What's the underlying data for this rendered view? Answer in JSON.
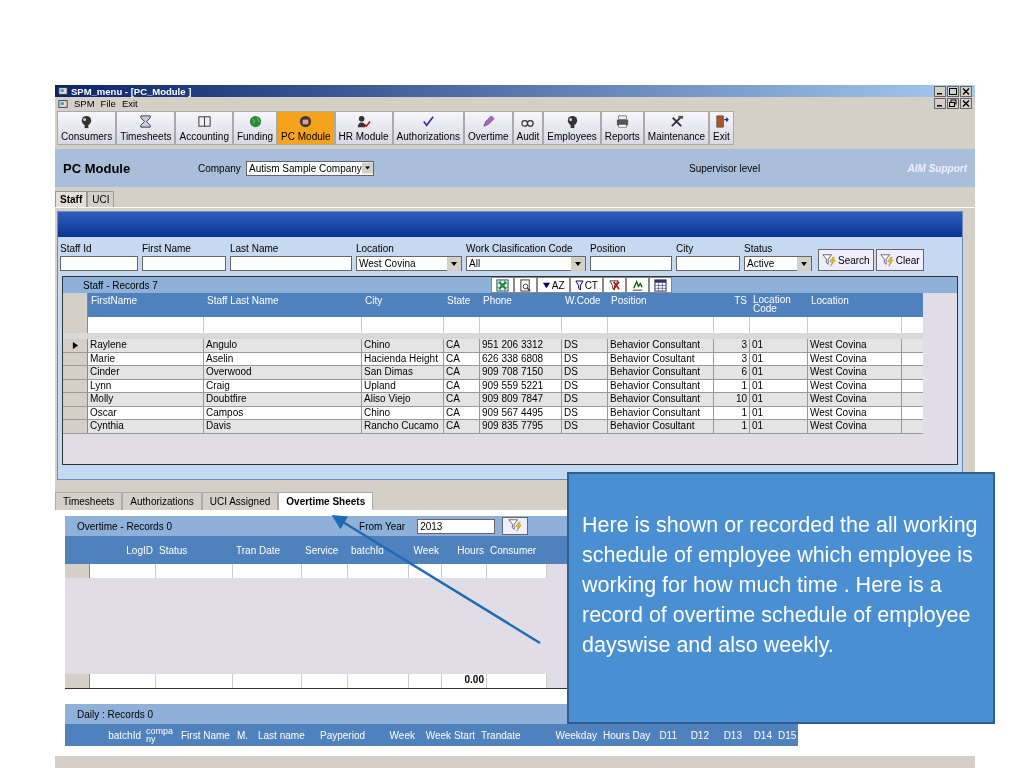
{
  "window": {
    "title": "SPM_menu - [PC_Module ]"
  },
  "menu": [
    "SPM",
    "File",
    "Exit"
  ],
  "toolbar": [
    {
      "label": "Consumers",
      "selected": false
    },
    {
      "label": "Timesheets",
      "selected": false
    },
    {
      "label": "Accounting",
      "selected": false
    },
    {
      "label": "Funding",
      "selected": false
    },
    {
      "label": "PC Module",
      "selected": true
    },
    {
      "label": "HR Module",
      "selected": false
    },
    {
      "label": "Authorizations",
      "selected": false
    },
    {
      "label": "Overtime",
      "selected": false
    },
    {
      "label": "Audit",
      "selected": false
    },
    {
      "label": "Employees",
      "selected": false
    },
    {
      "label": "Reports",
      "selected": false
    },
    {
      "label": "Maintenance",
      "selected": false
    },
    {
      "label": "Exit",
      "selected": false
    }
  ],
  "header": {
    "title": "PC Module",
    "company_label": "Company",
    "company": "Autism Sample Company",
    "level": "Supervisor level",
    "support": "AIM Support"
  },
  "tabs": [
    {
      "label": "Staff",
      "selected": true
    },
    {
      "label": "UCI",
      "selected": false
    }
  ],
  "filters": [
    {
      "label": "Staff Id",
      "kind": "text"
    },
    {
      "label": "First Name",
      "kind": "text"
    },
    {
      "label": "Last Name",
      "kind": "text"
    },
    {
      "label": "Location",
      "kind": "select",
      "value": "West Covina"
    },
    {
      "label": "Work Clasification Code",
      "kind": "select",
      "value": "All"
    },
    {
      "label": "Position",
      "kind": "text"
    },
    {
      "label": "City",
      "kind": "text"
    },
    {
      "label": "Status",
      "kind": "select",
      "value": "Active"
    }
  ],
  "filter_buttons": [
    "Search",
    "Clear"
  ],
  "staff_grid": {
    "caption": "Staff - Records 7",
    "sort_label": "AZ",
    "filter_label": "CT",
    "columns": [
      "FirstName",
      "Staff Last Name",
      "City",
      "State",
      "Phone",
      "W.Code",
      "Position",
      "TS",
      "Location Code",
      "Location"
    ],
    "rows": [
      {
        "selected": true,
        "cells": [
          "Raylene",
          "Angulo",
          "Chino",
          "CA",
          "951 206 3312",
          "DS",
          "Behavior Consultant",
          "3",
          "01",
          "West Covina"
        ]
      },
      {
        "selected": false,
        "cells": [
          "Marie",
          "Aselin",
          "Hacienda Height",
          "CA",
          "626 338 6808",
          "DS",
          "Behavior Cosultant",
          "3",
          "01",
          "West Covina"
        ]
      },
      {
        "selected": false,
        "cells": [
          "Cinder",
          "Overwood",
          "San Dimas",
          "CA",
          "909 708 7150",
          "DS",
          "Behavior Consultant",
          "6",
          "01",
          "West Covina"
        ]
      },
      {
        "selected": false,
        "cells": [
          "Lynn",
          "Craig",
          "Upland",
          "CA",
          "909 559 5221",
          "DS",
          "Behavior Consultant",
          "1",
          "01",
          "West Covina"
        ]
      },
      {
        "selected": false,
        "cells": [
          "Molly",
          "Doubtfire",
          "Aliso Viejo",
          "CA",
          "909 809 7847",
          "DS",
          "Behavior Consultant",
          "10",
          "01",
          "West Covina"
        ]
      },
      {
        "selected": false,
        "cells": [
          "Oscar",
          "Campos",
          "Chino",
          "CA",
          "909 567 4495",
          "DS",
          "Behavior Consultant",
          "1",
          "01",
          "West Covina"
        ]
      },
      {
        "selected": false,
        "cells": [
          "Cynthia",
          "Davis",
          "Rancho Cucamo",
          "CA",
          "909 835 7795",
          "DS",
          "Behavior Cosultant",
          "1",
          "01",
          "West Covina"
        ]
      }
    ]
  },
  "lower_tabs": [
    {
      "label": "Timesheets",
      "selected": false
    },
    {
      "label": "Authorizations",
      "selected": false
    },
    {
      "label": "UCI Assigned",
      "selected": false
    },
    {
      "label": "Overtime Sheets",
      "selected": true
    }
  ],
  "overtime": {
    "caption": "Overtime  - Records 0",
    "year_label": "From Year",
    "year": "2013",
    "columns": [
      "LogID",
      "Status",
      "Tran Date",
      "Service",
      "batchId",
      "Week",
      "Hours",
      "Consumer"
    ],
    "total": "0.00"
  },
  "daily": {
    "caption": "Daily : Records 0",
    "columns": [
      "batchId",
      "company",
      "First Name",
      "M.",
      "Last name",
      "Payperiod",
      "Week",
      "Week Start",
      "Trandate",
      "Weekday",
      "Hours Day",
      "D11",
      "D12",
      "D13",
      "D14",
      "D15"
    ]
  },
  "callout": {
    "text": "Here is shown or recorded the all working schedule of employee which employee is working for how much time . Here is a record of overtime schedule of employee dayswise and also weekly."
  }
}
